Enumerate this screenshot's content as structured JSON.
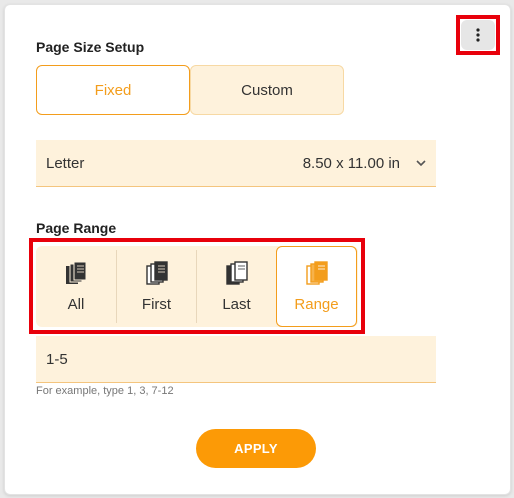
{
  "menu": {
    "icon": "more-vertical-icon"
  },
  "page_size": {
    "title": "Page Size Setup",
    "modes": [
      {
        "label": "Fixed",
        "selected": true
      },
      {
        "label": "Custom",
        "selected": false
      }
    ],
    "paper": {
      "name": "Letter",
      "dimensions": "8.50 x 11.00 in",
      "icon": "chevron-down-icon"
    }
  },
  "page_range": {
    "title": "Page Range",
    "options": [
      {
        "label": "All",
        "icon": "pages-all-icon",
        "selected": false
      },
      {
        "label": "First",
        "icon": "pages-first-icon",
        "selected": false
      },
      {
        "label": "Last",
        "icon": "pages-last-icon",
        "selected": false
      },
      {
        "label": "Range",
        "icon": "pages-range-icon",
        "selected": true
      }
    ],
    "input_value": "1-5",
    "hint": "For example, type 1, 3, 7-12"
  },
  "apply_label": "APPLY",
  "colors": {
    "accent": "#fc9a06",
    "field_bg": "#fef2dc",
    "highlight": "#e8000b"
  }
}
